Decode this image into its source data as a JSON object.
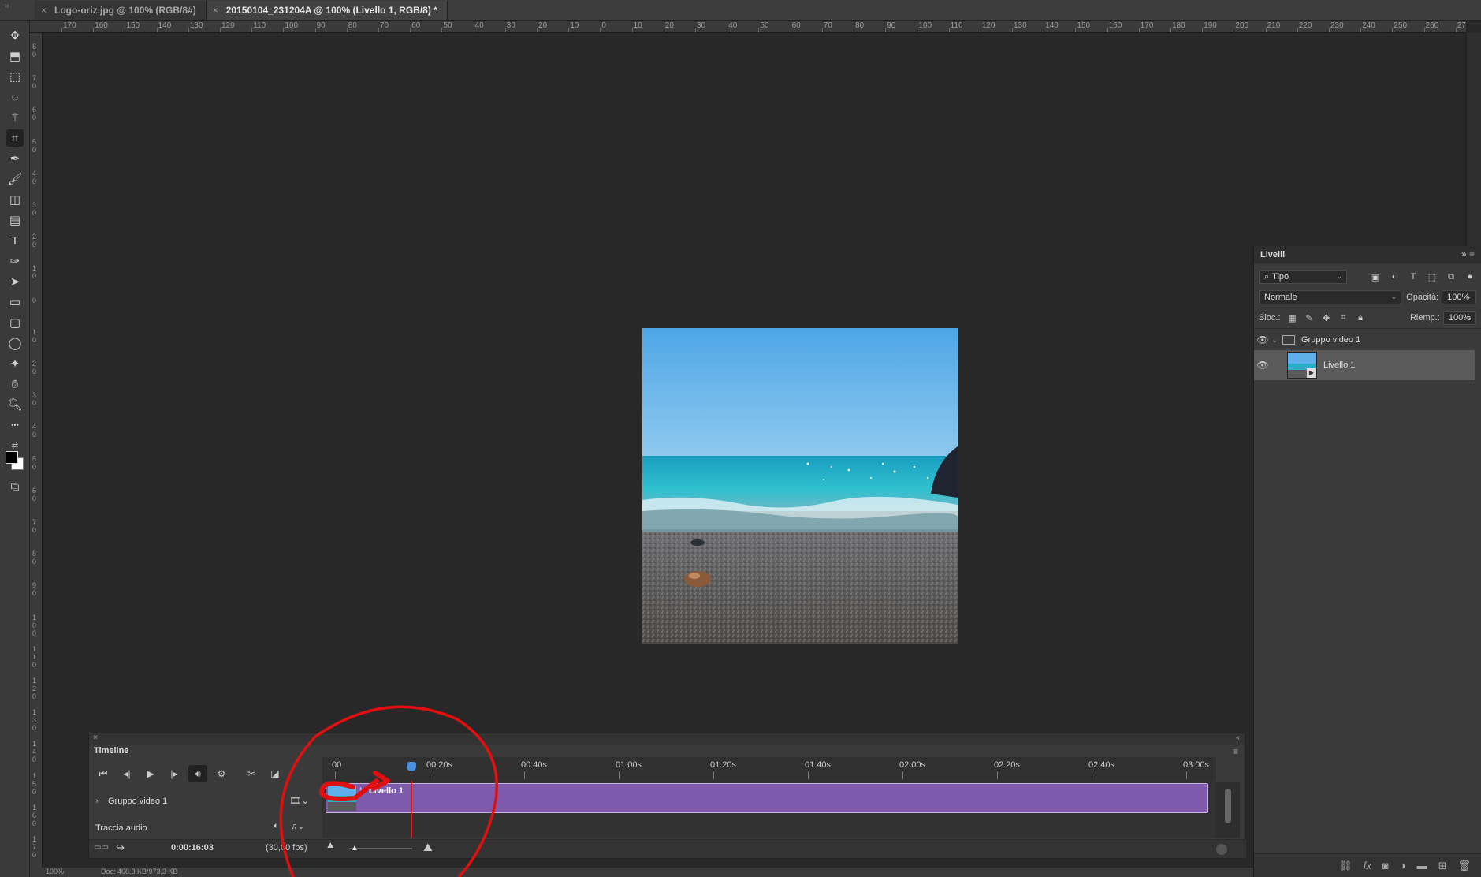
{
  "tabs": [
    {
      "label": "Logo-oriz.jpg @ 100% (RGB/8#)",
      "active": false
    },
    {
      "label": "20150104_231204A @ 100% (Livello 1, RGB/8) *",
      "active": true
    }
  ],
  "toolbar": {
    "icons": [
      "move-icon",
      "artboard-icon",
      "marquee-icon",
      "lasso-icon",
      "magic-wand-icon",
      "crop-icon",
      "eyedropper-icon",
      "brush-icon",
      "eraser-icon",
      "gradient-icon",
      "type-icon",
      "pen-icon",
      "path-select-icon",
      "rectangle-icon",
      "rounded-rect-icon",
      "ellipse-icon",
      "custom-shape-icon",
      "hand-icon",
      "zoom-icon",
      "more-tools-icon",
      "swap-colors-icon",
      "screen-mode-icon"
    ],
    "active": "crop-icon"
  },
  "ruler_top": [
    "170",
    "160",
    "150",
    "140",
    "130",
    "120",
    "110",
    "100",
    "90",
    "80",
    "70",
    "60",
    "50",
    "40",
    "30",
    "20",
    "10",
    "0",
    "10",
    "20",
    "30",
    "40",
    "50",
    "60",
    "70",
    "80",
    "90",
    "100",
    "110",
    "120",
    "130",
    "140",
    "150",
    "160",
    "170",
    "180",
    "190",
    "200",
    "210",
    "220",
    "230",
    "240",
    "250",
    "260",
    "270"
  ],
  "ruler_left": [
    "80",
    "70",
    "60",
    "50",
    "40",
    "30",
    "20",
    "10",
    "0",
    "10",
    "20",
    "30",
    "40",
    "50",
    "60",
    "70",
    "80",
    "90",
    "100",
    "110",
    "120",
    "130",
    "140",
    "150",
    "160",
    "170"
  ],
  "layers_panel": {
    "title": "Livelli",
    "filter_label": "Tipo",
    "blend_mode": "Normale",
    "opacity_label": "Opacità:",
    "opacity_value": "100%",
    "lock_label": "Bloc.:",
    "fill_label": "Riemp.:",
    "fill_value": "100%",
    "layers": [
      {
        "name": "Gruppo video 1",
        "type": "group",
        "visible": true
      },
      {
        "name": "Livello 1",
        "type": "video",
        "visible": true,
        "selected": true
      }
    ],
    "bottom_icons": [
      "link-icon",
      "fx-icon",
      "mask-icon",
      "adjustment-icon",
      "folder-icon",
      "new-layer-icon",
      "trash-icon"
    ]
  },
  "timeline": {
    "title": "Timeline",
    "timecodes": [
      "00",
      "00:20s",
      "00:40s",
      "01:00s",
      "01:20s",
      "01:40s",
      "02:00s",
      "02:20s",
      "02:40s",
      "03:00s"
    ],
    "tracks": [
      {
        "name": "Gruppo video 1"
      },
      {
        "name": "Traccia audio"
      }
    ],
    "clip_name": "Livello 1",
    "current_time": "0:00:16:03",
    "fps": "(30,00 fps)",
    "playhead_seconds": 16.1
  },
  "status": {
    "zoom": "100%",
    "doc": "Doc: 468,8 KB/973,3 KB"
  },
  "colors": {
    "clip": "#7e5aad",
    "annotation": "#e01010",
    "playhead": "#e02020"
  }
}
